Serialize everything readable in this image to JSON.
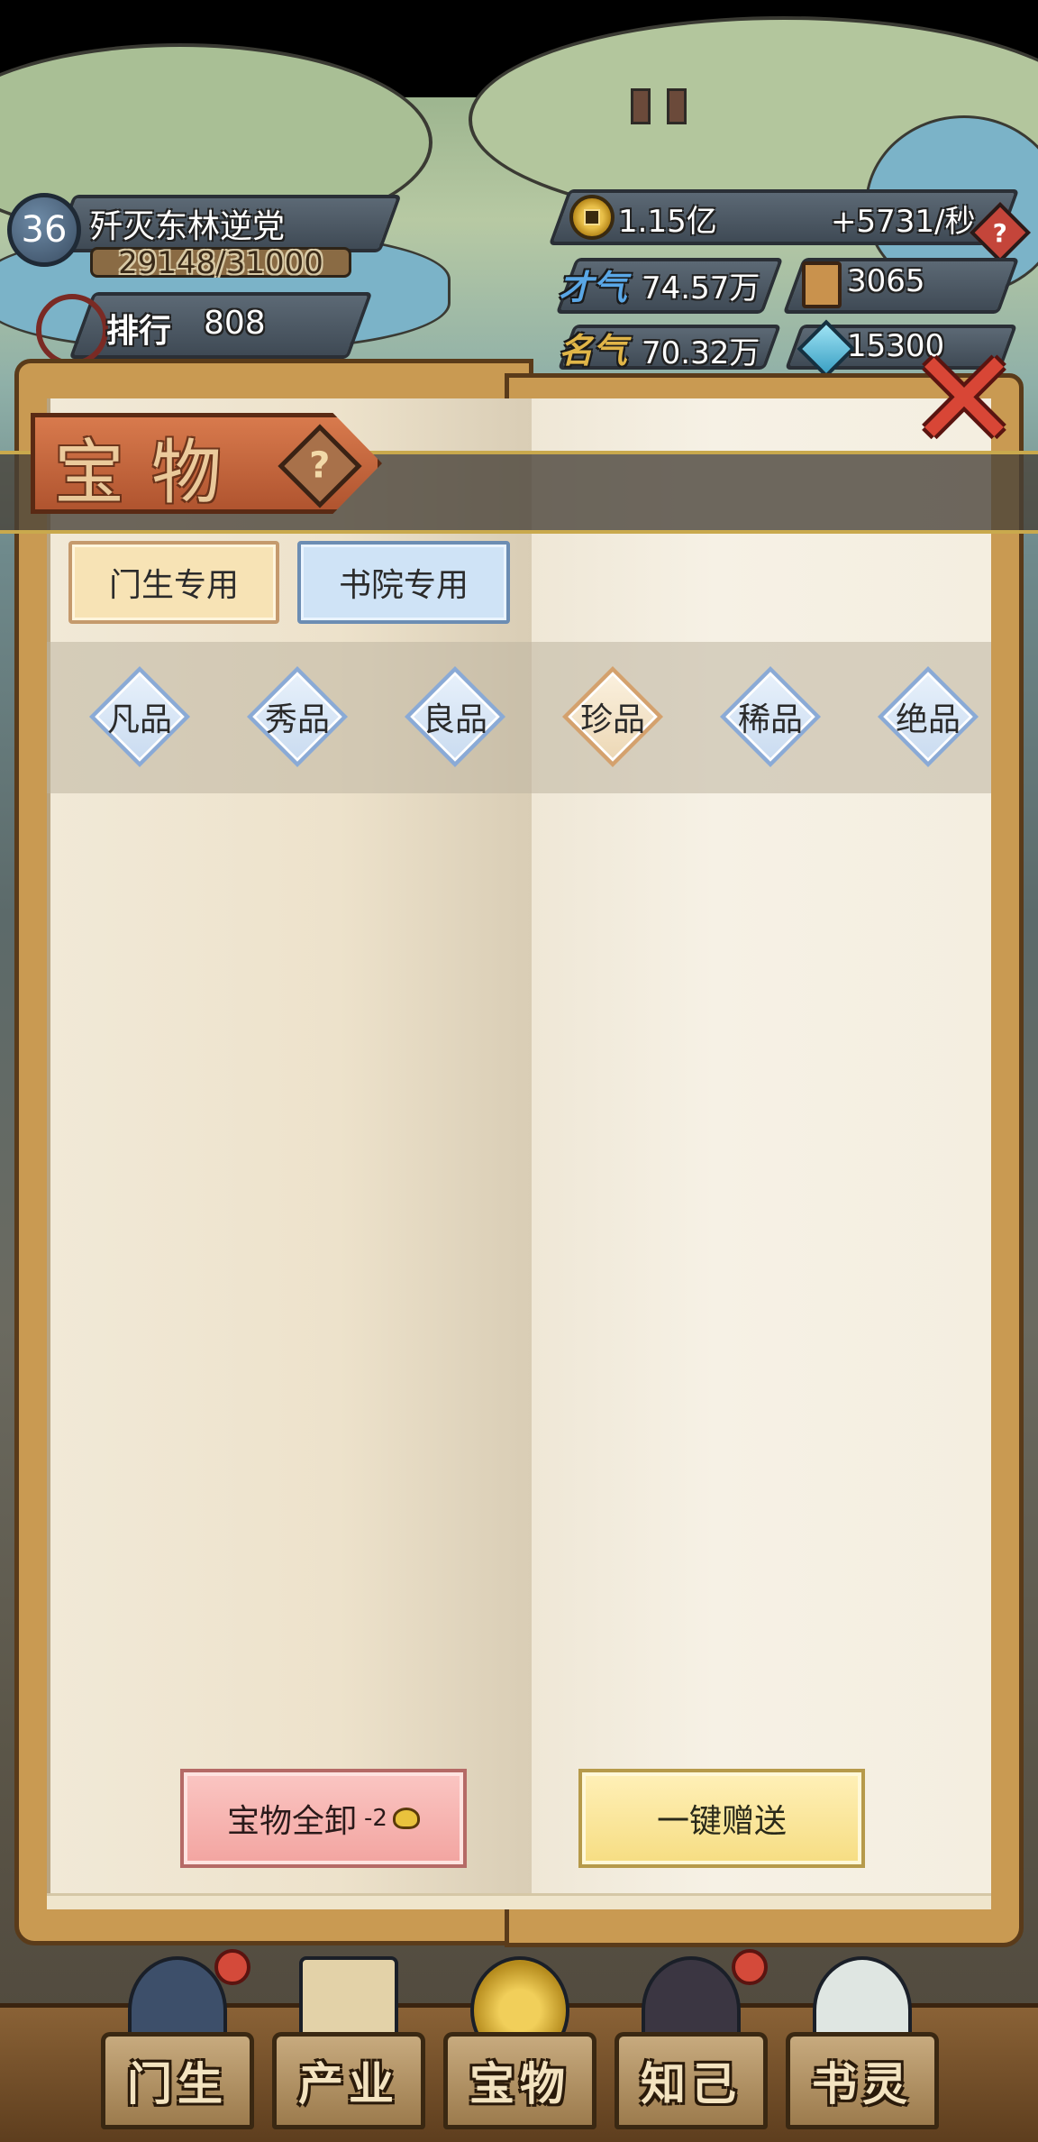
{
  "player": {
    "level": "36",
    "name": "歼灭东林逆党",
    "exp": "29148/31000",
    "rank_label": "排行",
    "rank_value": "808"
  },
  "resources": {
    "coins": "1.15亿",
    "coin_rate": "+5731/秒",
    "talent_label": "才气",
    "talent": "74.57万",
    "book_count": "3065",
    "fame_label": "名气",
    "fame": "70.32万",
    "gems": "15300"
  },
  "panel": {
    "title": "宝物",
    "help": "?",
    "close": "✕"
  },
  "tabs": [
    {
      "label": "门生专用"
    },
    {
      "label": "书院专用"
    }
  ],
  "grades": [
    {
      "label": "凡品",
      "selected": false
    },
    {
      "label": "秀品",
      "selected": false
    },
    {
      "label": "良品",
      "selected": false
    },
    {
      "label": "珍品",
      "selected": true
    },
    {
      "label": "稀品",
      "selected": false
    },
    {
      "label": "绝品",
      "selected": false
    }
  ],
  "actions": {
    "unequip_label": "宝物全卸",
    "unequip_cost": "-2",
    "gift_label": "一键赠送"
  },
  "nav": [
    {
      "label": "门生",
      "icon": "student-portrait"
    },
    {
      "label": "产业",
      "icon": "map-scroll"
    },
    {
      "label": "宝物",
      "icon": "treasure-compass"
    },
    {
      "label": "知己",
      "icon": "confidant-portrait"
    },
    {
      "label": "书灵",
      "icon": "book-spirit-portrait"
    }
  ],
  "colors": {
    "accent_red": "#d84636",
    "selected_grade": "#d4a16d",
    "grade_blue": "#8aaad6"
  }
}
